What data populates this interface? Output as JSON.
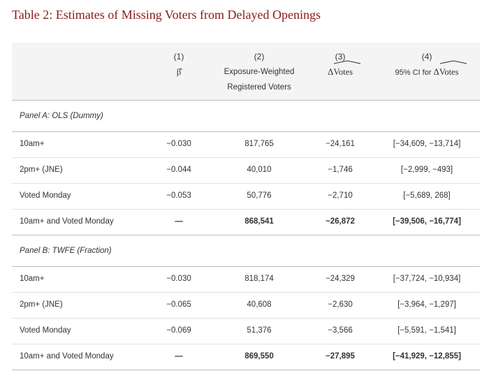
{
  "title": "Table 2: Estimates of Missing Voters from Delayed Openings",
  "header": {
    "col1_num": "(1)",
    "col1_sym": "β̂",
    "col2_num": "(2)",
    "col2_line1": "Exposure-Weighted",
    "col2_line2": "Registered Voters",
    "col3_num": "(3)",
    "col3_delta": "Δ",
    "col3_word": "Votes",
    "col4_num": "(4)",
    "col4_prefix": "95% CI for ",
    "col4_delta": "Δ",
    "col4_word": "Votes"
  },
  "panels": [
    {
      "label": "Panel A: OLS (Dummy)",
      "rows": [
        {
          "label": "10am+",
          "beta": "−0.030",
          "exposure": "817,765",
          "delta": "−24,161",
          "ci": "[−34,609, −13,714]"
        },
        {
          "label": "2pm+ (JNE)",
          "beta": "−0.044",
          "exposure": "40,010",
          "delta": "−1,746",
          "ci": "[−2,999, −493]"
        },
        {
          "label": "Voted Monday",
          "beta": "−0.053",
          "exposure": "50,776",
          "delta": "−2,710",
          "ci": "[−5,689, 268]"
        },
        {
          "label": "10am+ and Voted Monday",
          "beta": "—",
          "exposure": "868,541",
          "delta": "−26,872",
          "ci": "[−39,506, −16,774]"
        }
      ]
    },
    {
      "label": "Panel B: TWFE (Fraction)",
      "rows": [
        {
          "label": "10am+",
          "beta": "−0.030",
          "exposure": "818,174",
          "delta": "−24,329",
          "ci": "[−37,724, −10,934]"
        },
        {
          "label": "2pm+ (JNE)",
          "beta": "−0.065",
          "exposure": "40,608",
          "delta": "−2,630",
          "ci": "[−3,964, −1,297]"
        },
        {
          "label": "Voted Monday",
          "beta": "−0.069",
          "exposure": "51,376",
          "delta": "−3,566",
          "ci": "[−5,591, −1,541]"
        },
        {
          "label": "10am+ and Voted Monday",
          "beta": "—",
          "exposure": "869,550",
          "delta": "−27,895",
          "ci": "[−41,929, −12,855]"
        }
      ]
    }
  ]
}
